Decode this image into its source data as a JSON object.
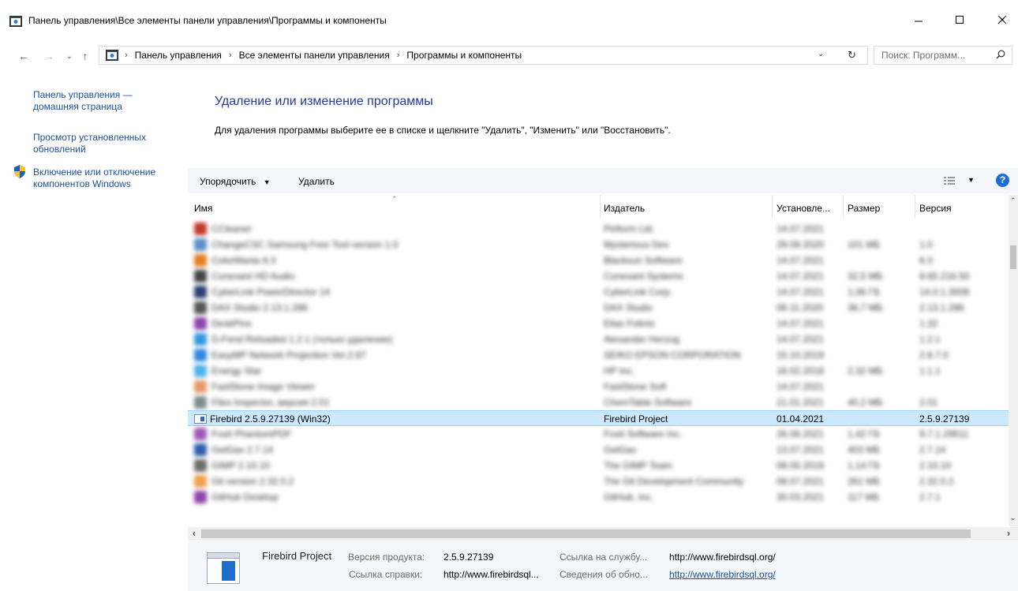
{
  "window": {
    "title": "Панель управления\\Все элементы панели управления\\Программы и компоненты",
    "minimize_icon": "minimize-icon",
    "maximize_icon": "maximize-icon",
    "close_icon": "close-icon"
  },
  "address": {
    "crumbs": [
      "Панель управления",
      "Все элементы панели управления",
      "Программы и компоненты"
    ],
    "search_placeholder": "Поиск: Программ..."
  },
  "sidebar": {
    "items": [
      {
        "label_line1": "Панель управления —",
        "label_line2": "домашняя страница"
      },
      {
        "label_line1": "Просмотр установленных",
        "label_line2": "обновлений"
      },
      {
        "label_line1": "Включение или отключение",
        "label_line2": "компонентов Windows",
        "icon": "shield-icon"
      }
    ]
  },
  "main": {
    "heading": "Удаление или изменение программы",
    "description": "Для удаления программы выберите ее в списке и щелкните \"Удалить\", \"Изменить\" или \"Восстановить\"."
  },
  "toolbar": {
    "organize_label": "Упорядочить",
    "uninstall_label": "Удалить",
    "view_icon": "view-options-icon",
    "help_icon": "help-icon",
    "help_text": "?"
  },
  "table": {
    "columns": [
      "Имя",
      "Издатель",
      "Установле...",
      "Размер",
      "Версия"
    ],
    "rows": [
      {
        "name": "CCleaner",
        "publisher": "Piriform Ltd.",
        "date": "14.07.2021",
        "size": "",
        "version": "",
        "color": "#c0392b"
      },
      {
        "name": "ChangeCSC Samsung Free Tool version 1.0",
        "publisher": "Mysterious Dev",
        "date": "29.09.2020",
        "size": "101 МБ",
        "version": "1.0",
        "color": "#5d8fc9"
      },
      {
        "name": "ColorMania 6.3",
        "publisher": "Blacksun Software",
        "date": "14.07.2021",
        "size": "",
        "version": "6.3",
        "color": "#e67e22"
      },
      {
        "name": "Conexant HD Audio",
        "publisher": "Conexant Systems",
        "date": "14.07.2021",
        "size": "32,5 МБ",
        "version": "8.65.216.50",
        "color": "#444444"
      },
      {
        "name": "CyberLink PowerDirector 14",
        "publisher": "CyberLink Corp.",
        "date": "14.07.2021",
        "size": "1,06 ГБ",
        "version": "14.0.1.3008",
        "color": "#2c3e70"
      },
      {
        "name": "DAX Studio 2.13.1.286",
        "publisher": "DAX Studio",
        "date": "06.11.2020",
        "size": "36,7 МБ",
        "version": "2.13.1.286",
        "color": "#555555"
      },
      {
        "name": "DeskPins",
        "publisher": "Elias Fotinis",
        "date": "14.07.2021",
        "size": "",
        "version": "1.32",
        "color": "#8e44ad"
      },
      {
        "name": "D-Fend Reloaded 1.2.1 (только удаление)",
        "publisher": "Alexander Herzog",
        "date": "14.07.2021",
        "size": "",
        "version": "1.2.1",
        "color": "#3498db"
      },
      {
        "name": "EasyMP Network Projection Ver.2.87",
        "publisher": "SEIKO EPSON CORPORATION",
        "date": "15.10.2019",
        "size": "",
        "version": "2.8.7.0",
        "color": "#2e86de"
      },
      {
        "name": "Energy Star",
        "publisher": "HP Inc.",
        "date": "16.02.2018",
        "size": "2,32 МБ",
        "version": "1.1.1",
        "color": "#4fb3e8"
      },
      {
        "name": "FastStone Image Viewer",
        "publisher": "FastStone Soft",
        "date": "14.07.2021",
        "size": "",
        "version": "",
        "color": "#e59866"
      },
      {
        "name": "Files Inspector, версия 2.01",
        "publisher": "ChemTable Software",
        "date": "21.01.2021",
        "size": "40,2 МБ",
        "version": "2.01",
        "color": "#7f8c8d"
      },
      {
        "name": "Firebird 2.5.9.27139 (Win32)",
        "publisher": "Firebird Project",
        "date": "01.04.2021",
        "size": "",
        "version": "2.5.9.27139",
        "color": "#2b6cb8",
        "selected": true
      },
      {
        "name": "Foxit PhantomPDF",
        "publisher": "Foxit Software Inc.",
        "date": "26.06.2021",
        "size": "1,42 ГБ",
        "version": "9.7.1.29511",
        "color": "#9b59b6"
      },
      {
        "name": "GetGav 2.7.14",
        "publisher": "GetGav",
        "date": "13.07.2021",
        "size": "403 МБ",
        "version": "2.7.14",
        "color": "#2c5fa8"
      },
      {
        "name": "GIMP 2.10.10",
        "publisher": "The GIMP Team",
        "date": "08.05.2019",
        "size": "1,14 ГБ",
        "version": "2.10.10",
        "color": "#6d6d6d"
      },
      {
        "name": "Git version 2.32.0.2",
        "publisher": "The Git Development Community",
        "date": "08.07.2021",
        "size": "261 МБ",
        "version": "2.32.0.2",
        "color": "#f0a04b"
      },
      {
        "name": "GitHub Desktop",
        "publisher": "GitHub, Inc.",
        "date": "30.03.2021",
        "size": "117 МБ",
        "version": "2.7.1",
        "color": "#8e44ad"
      }
    ]
  },
  "details": {
    "product": "Firebird Project",
    "version_label": "Версия продукта:",
    "version_value": "2.5.9.27139",
    "support_link_label": "Ссылка на службу...",
    "support_link_value": "http://www.firebirdsql.org/",
    "help_link_label": "Ссылка справки:",
    "help_link_value": "http://www.firebirdsql...",
    "update_info_label": "Сведения об обно...",
    "update_info_value": "http://www.firebirdsql.org/"
  }
}
